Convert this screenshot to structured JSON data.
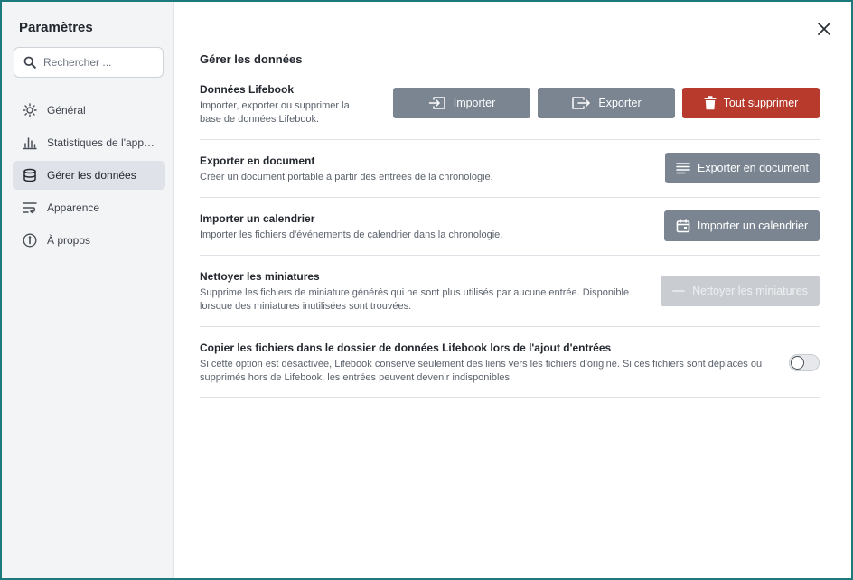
{
  "sidebar": {
    "title": "Paramètres",
    "search": {
      "placeholder": "Rechercher ...",
      "value": ""
    },
    "items": [
      {
        "label": "Général",
        "icon": "sun-icon",
        "active": false
      },
      {
        "label": "Statistiques de l'appli...",
        "icon": "bar-chart-icon",
        "active": false
      },
      {
        "label": "Gérer les données",
        "icon": "database-icon",
        "active": true
      },
      {
        "label": "Apparence",
        "icon": "text-wrap-icon",
        "active": false
      },
      {
        "label": "À propos",
        "icon": "info-icon",
        "active": false
      }
    ]
  },
  "main": {
    "section_title": "Gérer les données",
    "rows": [
      {
        "title": "Données Lifebook",
        "description": "Importer, exporter ou supprimer la base de données Lifebook.",
        "buttons": [
          {
            "label": "Importer",
            "icon": "import-icon"
          },
          {
            "label": "Exporter",
            "icon": "export-icon"
          },
          {
            "label": "Tout supprimer",
            "icon": "trash-icon"
          }
        ]
      },
      {
        "title": "Exporter en document",
        "description": "Créer un document portable à partir des entrées de la chronologie.",
        "buttons": [
          {
            "label": "Exporter en document",
            "icon": "lines-icon"
          }
        ]
      },
      {
        "title": "Importer un calendrier",
        "description": "Importer les fichiers d'événements de calendrier dans la chronologie.",
        "buttons": [
          {
            "label": "Importer un calendrier",
            "icon": "calendar-icon"
          }
        ]
      },
      {
        "title": "Nettoyer les miniatures",
        "description": "Supprime les fichiers de miniature générés qui ne sont plus utilisés par aucune entrée. Disponible lorsque des miniatures inutilisées sont trouvées.",
        "buttons": [
          {
            "label": "Nettoyer les miniatures",
            "icon": "minus-icon",
            "disabled": true
          }
        ]
      },
      {
        "title": "Copier les fichiers dans le dossier de données Lifebook lors de l'ajout d'entrées",
        "description": "Si cette option est désactivée, Lifebook conserve seulement des liens vers les fichiers d'origine. Si ces fichiers sont déplacés ou supprimés hors de Lifebook, les entrées peuvent devenir indisponibles.",
        "toggle_on": false
      }
    ]
  },
  "colors": {
    "accent": "#1c7a7a",
    "button": "#7b8591",
    "danger": "#b83a2c",
    "disabled": "#c9cdd2",
    "sidebar_bg": "#f3f4f6",
    "active_item": "#dfe3e9"
  }
}
